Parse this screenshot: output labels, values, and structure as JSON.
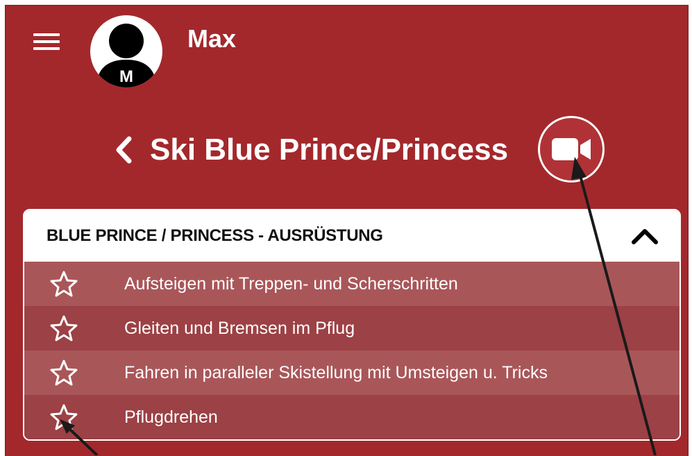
{
  "header": {
    "user_name": "Max",
    "avatar_initial": "M"
  },
  "page": {
    "title": "Ski Blue Prince/Princess"
  },
  "section": {
    "title": "BLUE PRINCE / PRINCESS - AUSRÜSTUNG",
    "expanded": true,
    "items": [
      {
        "label": "Aufsteigen mit Treppen- und Scherschritten",
        "starred": false
      },
      {
        "label": "Gleiten und Bremsen im Pflug",
        "starred": false
      },
      {
        "label": "Fahren in paralleler Skistellung mit Umsteigen u. Tricks",
        "starred": false
      },
      {
        "label": "Pflugdrehen",
        "starred": false
      }
    ]
  },
  "colors": {
    "header_bg": "#a3282c",
    "row_light": "#a95659",
    "row_dark": "#9c4145"
  }
}
